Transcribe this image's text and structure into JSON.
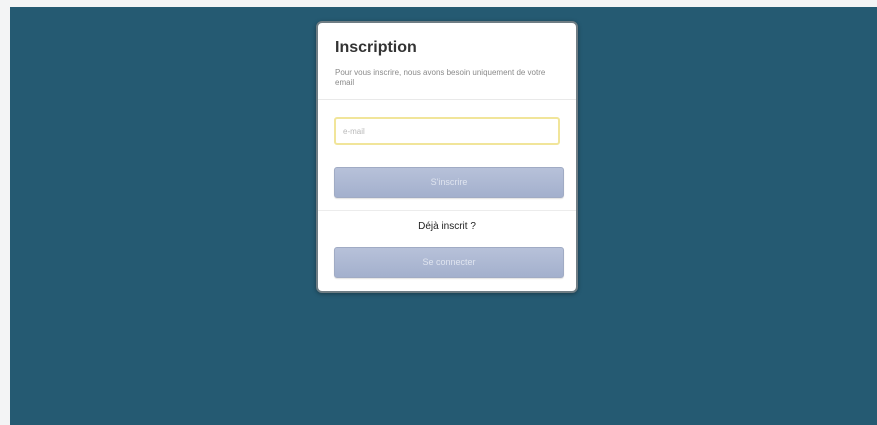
{
  "signup": {
    "title": "Inscription",
    "subtitle": "Pour vous inscrire, nous avons besoin uniquement de votre email",
    "email_placeholder": "e-mail",
    "email_value": "",
    "subscribe_label": "S'inscrire",
    "already_text": "Déjà inscrit ?",
    "login_label": "Se connecter"
  },
  "colors": {
    "background": "#255a72",
    "button": "#a9b5d1",
    "input_focus_border": "#f1e59a"
  }
}
